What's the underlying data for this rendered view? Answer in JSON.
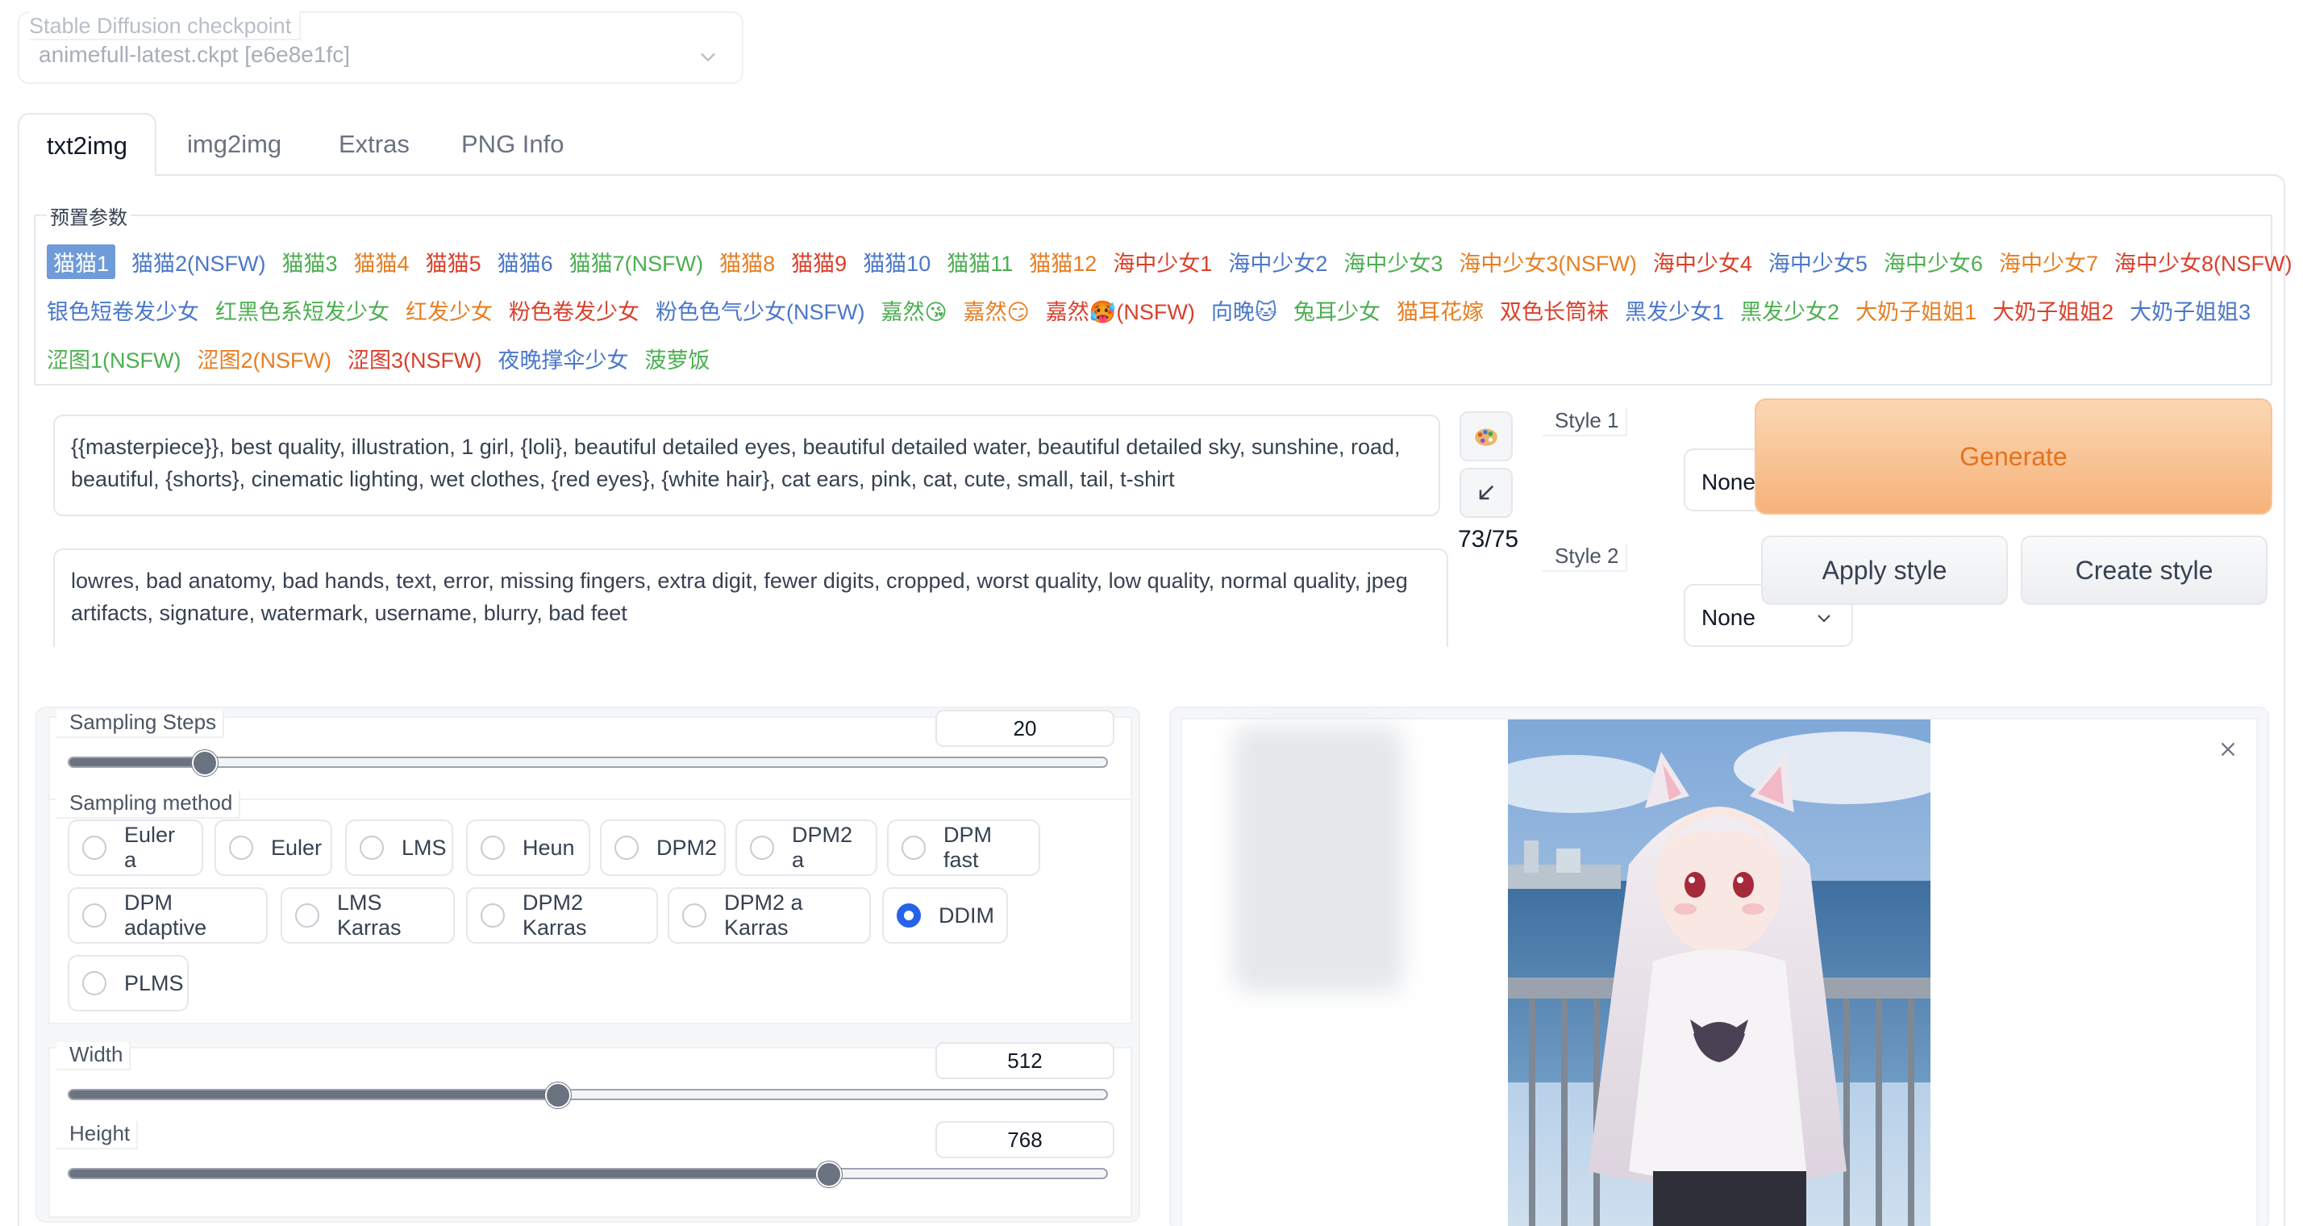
{
  "checkpoint": {
    "label": "Stable Diffusion checkpoint",
    "value": "animefull-latest.ckpt [e6e8e1fc]"
  },
  "tabs": [
    {
      "label": "txt2img",
      "active": true
    },
    {
      "label": "img2img",
      "active": false
    },
    {
      "label": "Extras",
      "active": false
    },
    {
      "label": "PNG Info",
      "active": false
    }
  ],
  "presets": {
    "legend": "预置参数",
    "rows": [
      [
        {
          "label": "猫猫1",
          "color": "#ffffff",
          "selected": true
        },
        {
          "label": "猫猫2(NSFW)",
          "color": "#4a77c9"
        },
        {
          "label": "猫猫3",
          "color": "#4caf50"
        },
        {
          "label": "猫猫4",
          "color": "#e67e22"
        },
        {
          "label": "猫猫5",
          "color": "#d9402b"
        },
        {
          "label": "猫猫6",
          "color": "#4a77c9"
        },
        {
          "label": "猫猫7(NSFW)",
          "color": "#4caf50"
        },
        {
          "label": "猫猫8",
          "color": "#e67e22"
        },
        {
          "label": "猫猫9",
          "color": "#d9402b"
        },
        {
          "label": "猫猫10",
          "color": "#4a77c9"
        },
        {
          "label": "猫猫11",
          "color": "#4caf50"
        },
        {
          "label": "猫猫12",
          "color": "#e67e22"
        },
        {
          "label": "海中少女1",
          "color": "#d9402b"
        },
        {
          "label": "海中少女2",
          "color": "#4a77c9"
        },
        {
          "label": "海中少女3",
          "color": "#4caf50"
        },
        {
          "label": "海中少女3(NSFW)",
          "color": "#e67e22"
        },
        {
          "label": "海中少女4",
          "color": "#d9402b"
        },
        {
          "label": "海中少女5",
          "color": "#4a77c9"
        },
        {
          "label": "海中少女6",
          "color": "#4caf50"
        },
        {
          "label": "海中少女7",
          "color": "#e67e22"
        },
        {
          "label": "海中少女8(NSFW)",
          "color": "#d9402b"
        }
      ],
      [
        {
          "label": "银色短卷发少女",
          "color": "#4a77c9"
        },
        {
          "label": "红黑色系短发少女",
          "color": "#4caf50"
        },
        {
          "label": "红发少女",
          "color": "#e67e22"
        },
        {
          "label": "粉色卷发少女",
          "color": "#d9402b"
        },
        {
          "label": "粉色色气少女(NSFW)",
          "color": "#4a77c9"
        },
        {
          "label": "嘉然😘",
          "color": "#4caf50"
        },
        {
          "label": "嘉然😏",
          "color": "#e67e22"
        },
        {
          "label": "嘉然🥵(NSFW)",
          "color": "#d9402b"
        },
        {
          "label": "向晚🐱",
          "color": "#4a77c9"
        },
        {
          "label": "兔耳少女",
          "color": "#4caf50"
        },
        {
          "label": "猫耳花嫁",
          "color": "#e67e22"
        },
        {
          "label": "双色长筒袜",
          "color": "#d9402b"
        },
        {
          "label": "黑发少女1",
          "color": "#4a77c9"
        },
        {
          "label": "黑发少女2",
          "color": "#4caf50"
        },
        {
          "label": "大奶子姐姐1",
          "color": "#e67e22"
        },
        {
          "label": "大奶子姐姐2",
          "color": "#d9402b"
        },
        {
          "label": "大奶子姐姐3",
          "color": "#4a77c9"
        }
      ],
      [
        {
          "label": "涩图1(NSFW)",
          "color": "#4caf50"
        },
        {
          "label": "涩图2(NSFW)",
          "color": "#e67e22"
        },
        {
          "label": "涩图3(NSFW)",
          "color": "#d9402b"
        },
        {
          "label": "夜晚撑伞少女",
          "color": "#4a77c9"
        },
        {
          "label": "菠萝饭",
          "color": "#4caf50"
        }
      ]
    ]
  },
  "prompt": "{{masterpiece}}, best quality, illustration, 1 girl, {loli}, beautiful detailed eyes, beautiful detailed water, beautiful detailed sky, sunshine, road, beautiful, {shorts}, cinematic lighting, wet clothes, {red eyes}, {white hair}, cat ears, pink, cat, cute, small, tail, t-shirt",
  "negative_prompt": "lowres, bad anatomy, bad hands, text, error, missing fingers, extra digit, fewer digits, cropped, worst quality, low quality, normal quality, jpeg artifacts, signature, watermark, username, blurry, bad feet",
  "token_counter": "73/75",
  "style1": {
    "label": "Style 1",
    "value": "None"
  },
  "style2": {
    "label": "Style 2",
    "value": "None"
  },
  "buttons": {
    "generate": "Generate",
    "apply_style": "Apply style",
    "create_style": "Create style"
  },
  "sampling_steps": {
    "label": "Sampling Steps",
    "value": "20",
    "fraction": 0.13
  },
  "sampling_method": {
    "label": "Sampling method",
    "selected": "DDIM",
    "options": [
      "Euler a",
      "Euler",
      "LMS",
      "Heun",
      "DPM2",
      "DPM2 a",
      "DPM fast",
      "DPM adaptive",
      "LMS Karras",
      "DPM2 Karras",
      "DPM2 a Karras",
      "DDIM",
      "PLMS"
    ]
  },
  "width": {
    "label": "Width",
    "value": "512",
    "fraction": 0.47
  },
  "height": {
    "label": "Height",
    "value": "768",
    "fraction": 0.73
  },
  "icons": {
    "paint": "palette-icon",
    "arrow": "arrow-down-left-icon",
    "close": "close-icon",
    "chevron": "chevron-down-icon"
  },
  "colors": {
    "generate_bg": "#f6b27a",
    "generate_text": "#e3731f",
    "selected_preset": "#6f9bd8",
    "radio_selected": "#2563eb"
  }
}
